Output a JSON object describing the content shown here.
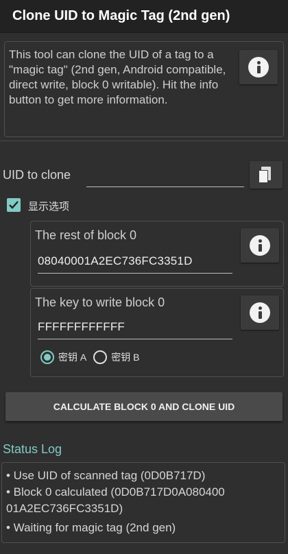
{
  "titlebar": {
    "title": "Clone UID to Magic Tag (2nd gen)"
  },
  "description": {
    "text": "This tool can clone the UID of a tag to a \"magic tag\" (2nd gen, Android compatible, direct write, block 0 writable). Hit the info button to get more information."
  },
  "uid": {
    "label": "UID to clone",
    "value": "",
    "paste_icon": "clipboard-paste-icon"
  },
  "options": {
    "checkbox_label": "显示选项",
    "checked": true
  },
  "block0": {
    "label": "The rest of block 0",
    "value": "08040001A2EC736FC3351D"
  },
  "key": {
    "label": "The key to write block 0",
    "value": "FFFFFFFFFFFF",
    "radio_a": "密钥 A",
    "radio_b": "密钥 B",
    "selected": "A"
  },
  "actions": {
    "calculate_label": "CALCULATE BLOCK 0 AND CLONE UID"
  },
  "status": {
    "title": "Status Log",
    "lines": [
      "• Use UID of scanned tag (0D0B717D)",
      "• Block 0 calculated (0D0B717D0A080400",
      "01A2EC736FC3351D)",
      "• Waiting for magic tag (2nd gen)"
    ]
  },
  "colors": {
    "accent": "#80cbc4",
    "background": "#2f2f2f",
    "titlebar": "#222222",
    "button": "#4a4a4a"
  }
}
